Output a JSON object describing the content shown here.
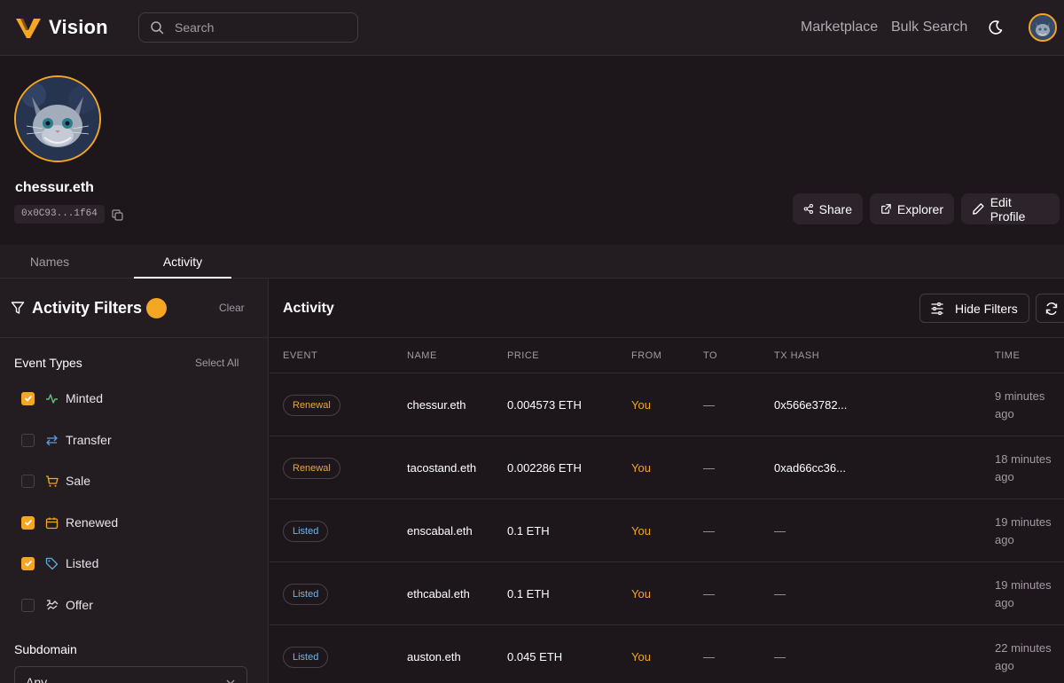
{
  "app": {
    "name": "Vision",
    "accent": "#f5a623"
  },
  "search": {
    "placeholder": "Search"
  },
  "nav": {
    "marketplace": "Marketplace",
    "bulk_search": "Bulk Search"
  },
  "profile": {
    "name": "chessur.eth",
    "address": "0x0C93...1f64",
    "buttons": {
      "share": "Share",
      "explorer": "Explorer",
      "edit": "Edit Profile"
    }
  },
  "tabs": [
    {
      "label": "Names"
    },
    {
      "label": "Activity",
      "active": true
    }
  ],
  "filters": {
    "title": "Activity Filters",
    "clear": "Clear",
    "event_types_title": "Event Types",
    "select_all": "Select All",
    "events": [
      {
        "label": "Minted",
        "checked": true,
        "icon": "activity-icon"
      },
      {
        "label": "Transfer",
        "checked": false,
        "icon": "transfer-icon"
      },
      {
        "label": "Sale",
        "checked": false,
        "icon": "cart-icon"
      },
      {
        "label": "Renewed",
        "checked": true,
        "icon": "calendar-icon"
      },
      {
        "label": "Listed",
        "checked": true,
        "icon": "tag-icon"
      },
      {
        "label": "Offer",
        "checked": false,
        "icon": "offer-icon"
      }
    ],
    "subdomain_title": "Subdomain",
    "subdomain_value": "Any"
  },
  "activity": {
    "title": "Activity",
    "hide_filters": "Hide Filters",
    "columns": {
      "event": "EVENT",
      "name": "NAME",
      "price": "PRICE",
      "from": "FROM",
      "to": "TO",
      "tx_hash": "TX HASH",
      "time": "TIME"
    },
    "rows": [
      {
        "event": "Renewal",
        "name": "chessur.eth",
        "price": "0.004573 ETH",
        "from": "You",
        "to": "—",
        "tx": "0x566e3782...",
        "time": "9 minutes ago"
      },
      {
        "event": "Renewal",
        "name": "tacostand.eth",
        "price": "0.002286 ETH",
        "from": "You",
        "to": "—",
        "tx": "0xad66cc36...",
        "time": "18 minutes ago"
      },
      {
        "event": "Listed",
        "name": "enscabal.eth",
        "price": "0.1 ETH",
        "from": "You",
        "to": "—",
        "tx": "—",
        "time": "19 minutes ago"
      },
      {
        "event": "Listed",
        "name": "ethcabal.eth",
        "price": "0.1 ETH",
        "from": "You",
        "to": "—",
        "tx": "—",
        "time": "19 minutes ago"
      },
      {
        "event": "Listed",
        "name": "auston.eth",
        "price": "0.045 ETH",
        "from": "You",
        "to": "—",
        "tx": "—",
        "time": "22 minutes ago"
      }
    ]
  }
}
